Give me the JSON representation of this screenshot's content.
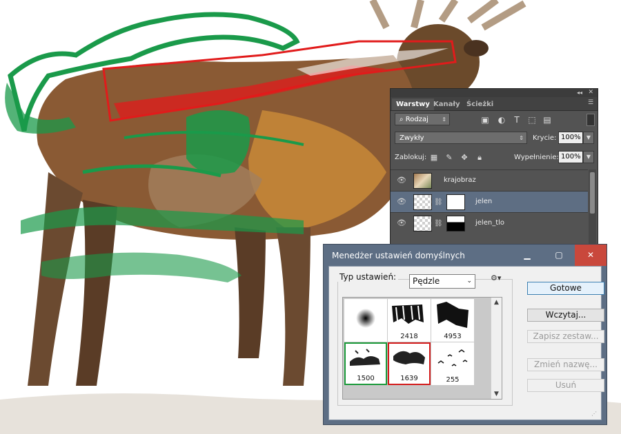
{
  "layers_panel": {
    "tabs": [
      "Warstwy",
      "Kanały",
      "Ścieżki"
    ],
    "filter_select": "Rodzaj",
    "blend_mode": "Zwykły",
    "opacity_label": "Krycie:",
    "opacity_value": "100%",
    "lock_label": "Zablokuj:",
    "fill_label": "Wypełnienie:",
    "fill_value": "100%",
    "layers": [
      {
        "name": "krajobraz",
        "selected": false
      },
      {
        "name": "jelen",
        "selected": true
      },
      {
        "name": "jelen_tlo",
        "selected": false
      }
    ]
  },
  "dialog": {
    "title": "Menedżer ustawień domyślnych",
    "type_label": "Typ ustawień:",
    "type_value": "Pędzle",
    "presets": [
      {
        "label": "",
        "highlight": "none"
      },
      {
        "label": "2418",
        "highlight": "none"
      },
      {
        "label": "4953",
        "highlight": "none"
      },
      {
        "label": "1500",
        "highlight": "green"
      },
      {
        "label": "1639",
        "highlight": "red"
      },
      {
        "label": "255",
        "highlight": "none"
      }
    ],
    "buttons": {
      "done": "Gotowe",
      "load": "Wczytaj...",
      "save_set": "Zapisz zestaw...",
      "rename": "Zmień nazwę...",
      "delete": "Usuń"
    }
  },
  "colors": {
    "panel_bg": "#535353",
    "selected_layer": "#5e6e83",
    "dialog_title_bar": "#5d6e84",
    "close_button": "#c9483c",
    "green_highlight": "#1a9a3a",
    "red_highlight": "#d41b1b"
  }
}
